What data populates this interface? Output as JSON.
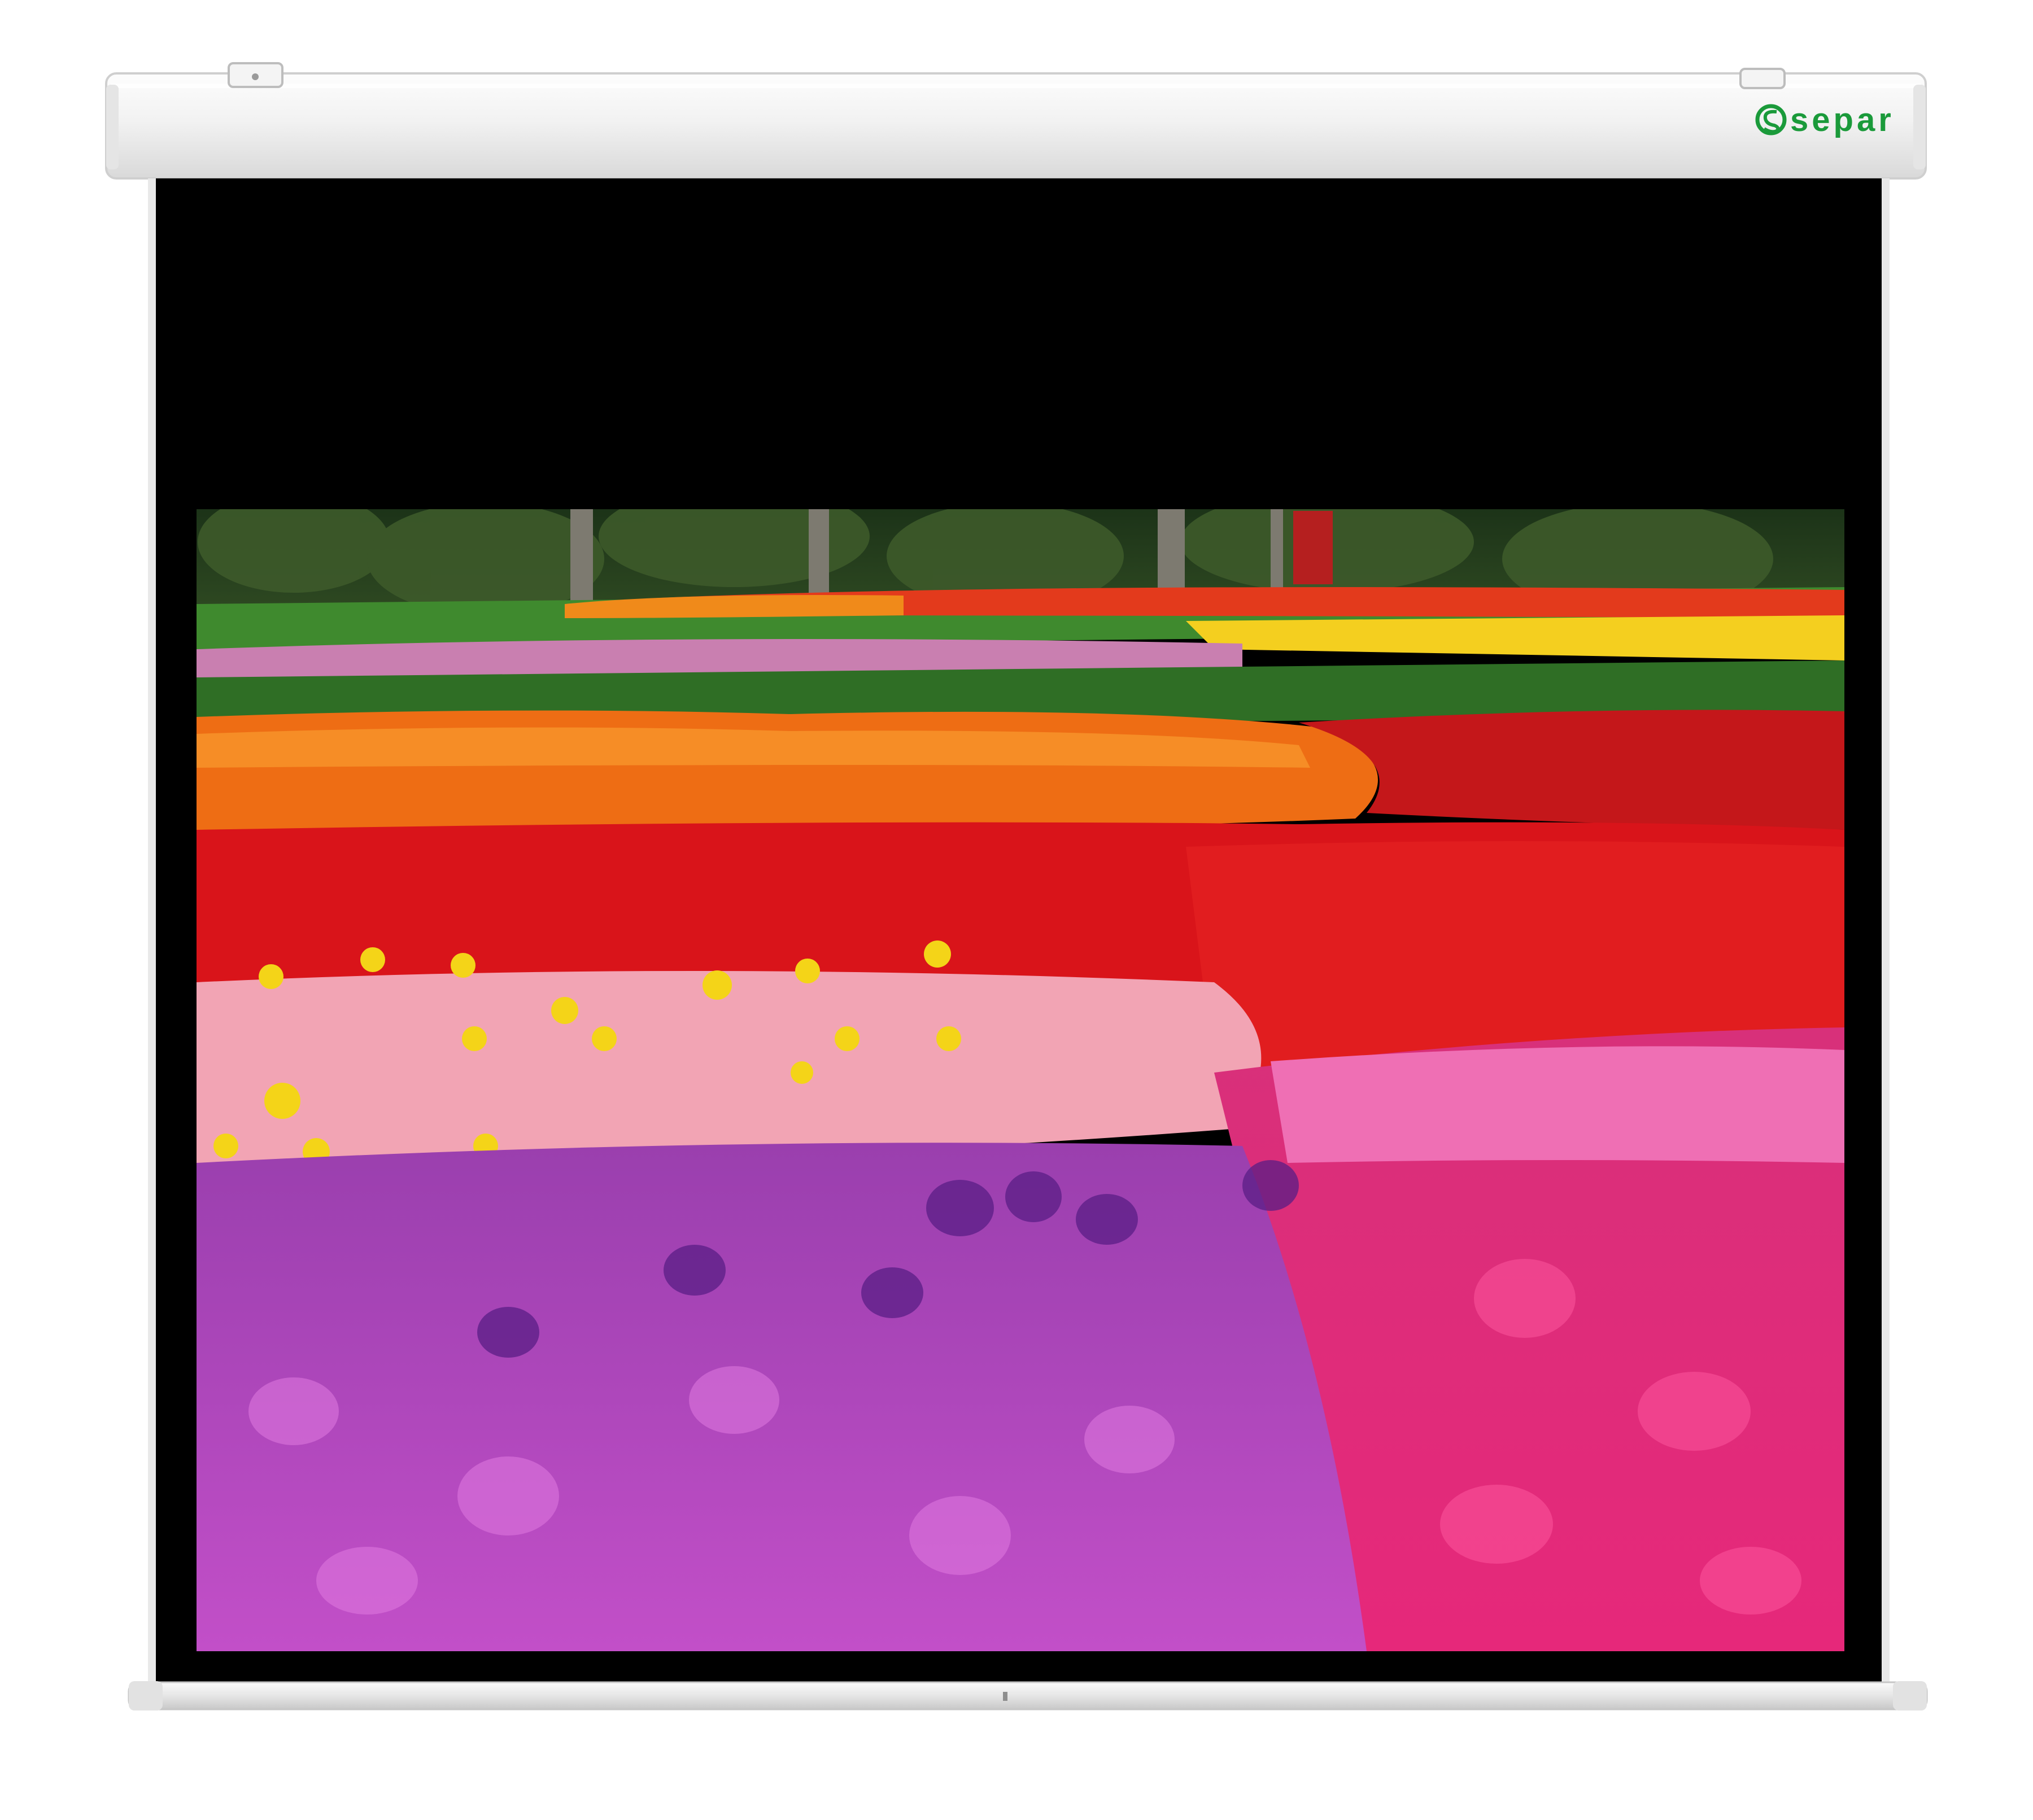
{
  "brand": {
    "logo_text": "separ",
    "logo_color": "#1a9a3a"
  },
  "colors": {
    "housing": "#f1f1f1",
    "black_border": "#000000",
    "bar": "#eaeaea"
  },
  "image": {
    "subject": "tulip field"
  }
}
